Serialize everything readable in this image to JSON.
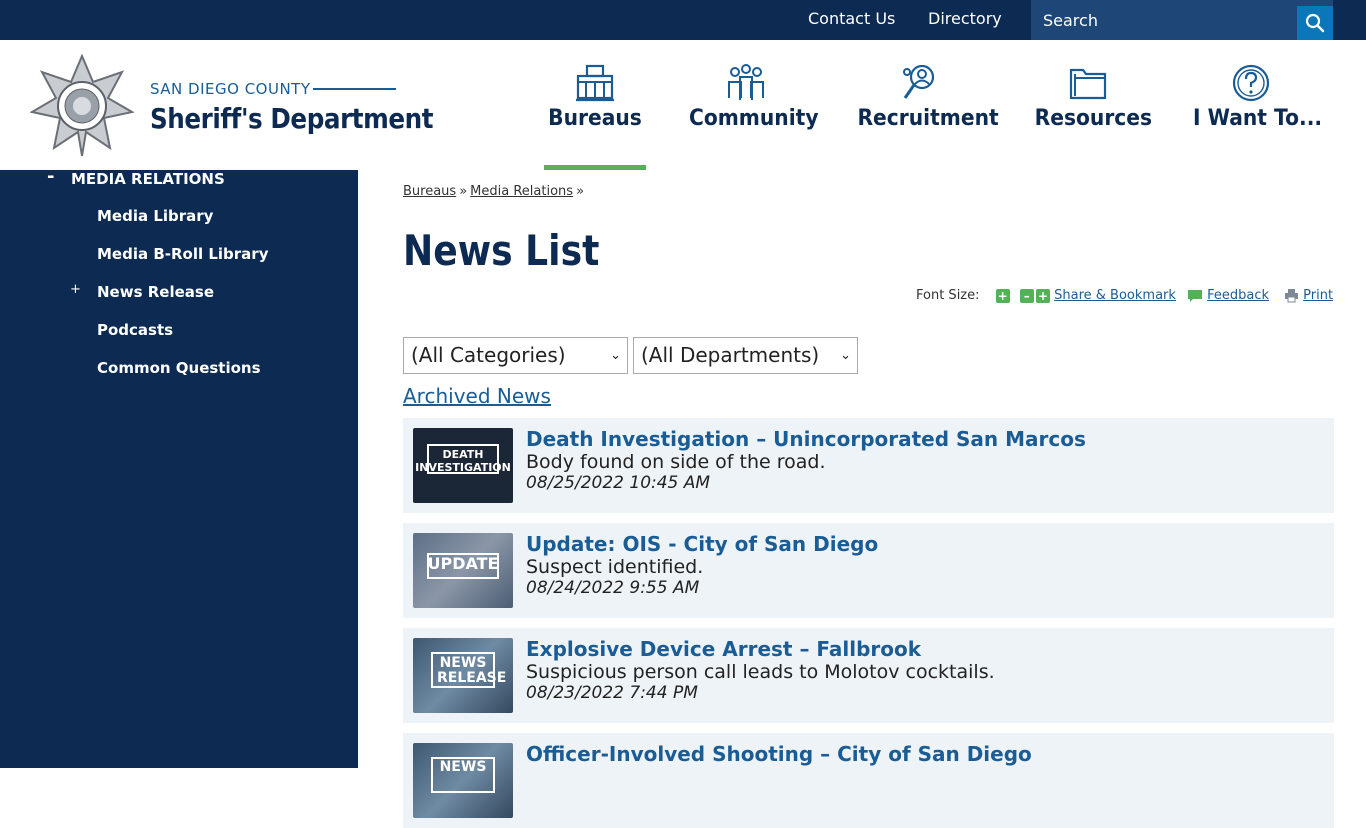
{
  "topbar": {
    "contact_label": "Contact Us",
    "directory_label": "Directory",
    "search_placeholder": "Search"
  },
  "header": {
    "org_top": "SAN DIEGO COUNTY",
    "org_main": "Sheriff's Department",
    "nav": [
      {
        "label": "Bureaus",
        "icon": "building-icon",
        "active": true
      },
      {
        "label": "Community",
        "icon": "people-group-icon",
        "active": false
      },
      {
        "label": "Recruitment",
        "icon": "person-search-icon",
        "active": false
      },
      {
        "label": "Resources",
        "icon": "folder-icon",
        "active": false
      },
      {
        "label": "I Want To...",
        "icon": "question-circle-icon",
        "active": false
      }
    ]
  },
  "sidebar": {
    "parent_label": "MEDIA RELATIONS",
    "items": [
      {
        "label": "Media Library",
        "expandable": false
      },
      {
        "label": "Media B-Roll Library",
        "expandable": false
      },
      {
        "label": "News Release",
        "expandable": true
      },
      {
        "label": "Podcasts",
        "expandable": false
      },
      {
        "label": "Common Questions",
        "expandable": false
      }
    ]
  },
  "breadcrumb": {
    "items": [
      "Bureaus",
      "Media Relations"
    ],
    "separator": "»"
  },
  "page_title": "News List",
  "tools": {
    "font_size_label": "Font Size:",
    "share_label": "Share & Bookmark",
    "feedback_label": "Feedback",
    "print_label": "Print"
  },
  "filters": {
    "categories_selected": "(All Categories)",
    "departments_selected": "(All Departments)"
  },
  "archived_label": "Archived News",
  "news": [
    {
      "title": "Death Investigation – Unincorporated San Marcos",
      "description": "Body found on side of the road.",
      "date": "08/25/2022 10:45 AM",
      "thumb_text": "DEATH INVESTIGATION"
    },
    {
      "title": "Update: OIS - City of San Diego",
      "description": "Suspect identified.",
      "date": "08/24/2022 9:55 AM",
      "thumb_text": "UPDATE"
    },
    {
      "title": "Explosive Device Arrest – Fallbrook",
      "description": "Suspicious person call leads to Molotov cocktails.",
      "date": "08/23/2022 7:44 PM",
      "thumb_text": "NEWS RELEASE"
    },
    {
      "title": "Officer-Involved Shooting – City of San Diego",
      "description": "",
      "date": "",
      "thumb_text": "NEWS"
    }
  ],
  "colors": {
    "navy": "#0c2a52",
    "accent_blue": "#1a5c96",
    "green": "#53b256",
    "card_bg": "#eef3f7"
  }
}
